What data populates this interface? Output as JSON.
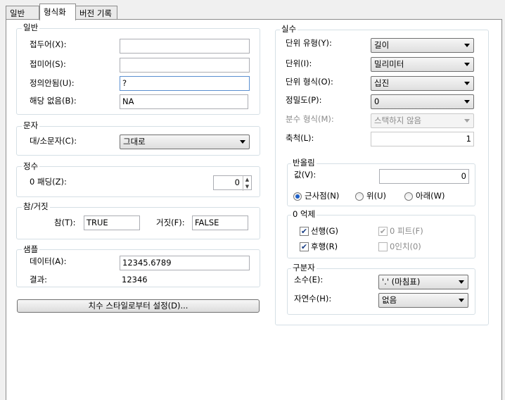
{
  "tabs": [
    {
      "label": "일반"
    },
    {
      "label": "형식화"
    },
    {
      "label": "버전 기록"
    }
  ],
  "general": {
    "title": "일반",
    "prefix_label": "접두어(X):",
    "prefix_value": "",
    "suffix_label": "접미어(S):",
    "suffix_value": "",
    "undefined_label": "정의안됨(U):",
    "undefined_value": "?",
    "na_label": "해당 없음(B):",
    "na_value": "NA"
  },
  "text": {
    "title": "문자",
    "case_label": "대/소문자(C):",
    "case_value": "그대로"
  },
  "integer": {
    "title": "정수",
    "zero_pad_label": "0 패딩(Z):",
    "zero_pad_value": "0"
  },
  "boolean": {
    "title": "참/거짓",
    "true_label": "참(T):",
    "true_value": "TRUE",
    "false_label": "거짓(F):",
    "false_value": "FALSE"
  },
  "sample": {
    "title": "샘플",
    "data_label": "데이터(A):",
    "data_value": "12345.6789",
    "result_label": "결과:",
    "result_value": "12346"
  },
  "set_from_style_button": "치수 스타일로부터 설정(D)...",
  "real": {
    "title": "실수",
    "unit_type_label": "단위 유형(Y):",
    "unit_type_value": "길이",
    "unit_label": "단위(I):",
    "unit_value": "밀리미터",
    "unit_format_label": "단위 형식(O):",
    "unit_format_value": "십진",
    "precision_label": "정밀도(P):",
    "precision_value": "0",
    "fraction_label": "분수 형식(M):",
    "fraction_value": "스택하지 않음",
    "scale_label": "축척(L):",
    "scale_value": "1"
  },
  "rounding": {
    "title": "반올림",
    "value_label": "값(V):",
    "value": "0",
    "nearest_label": "근사점(N)",
    "up_label": "위(U)",
    "down_label": "아래(W)",
    "selected": "nearest"
  },
  "zero_suppression": {
    "title": "0 억제",
    "leading_label": "선행(G)",
    "leading_checked": true,
    "trailing_label": "후행(R)",
    "trailing_checked": true,
    "feet_label": "0 피트(F)",
    "feet_checked": true,
    "inches_label": "0인치(0)",
    "inches_checked": false
  },
  "separator": {
    "title": "구분자",
    "decimal_label": "소수(E):",
    "decimal_value": "'.' (마침표)",
    "natural_label": "자연수(H):",
    "natural_value": "없음"
  }
}
